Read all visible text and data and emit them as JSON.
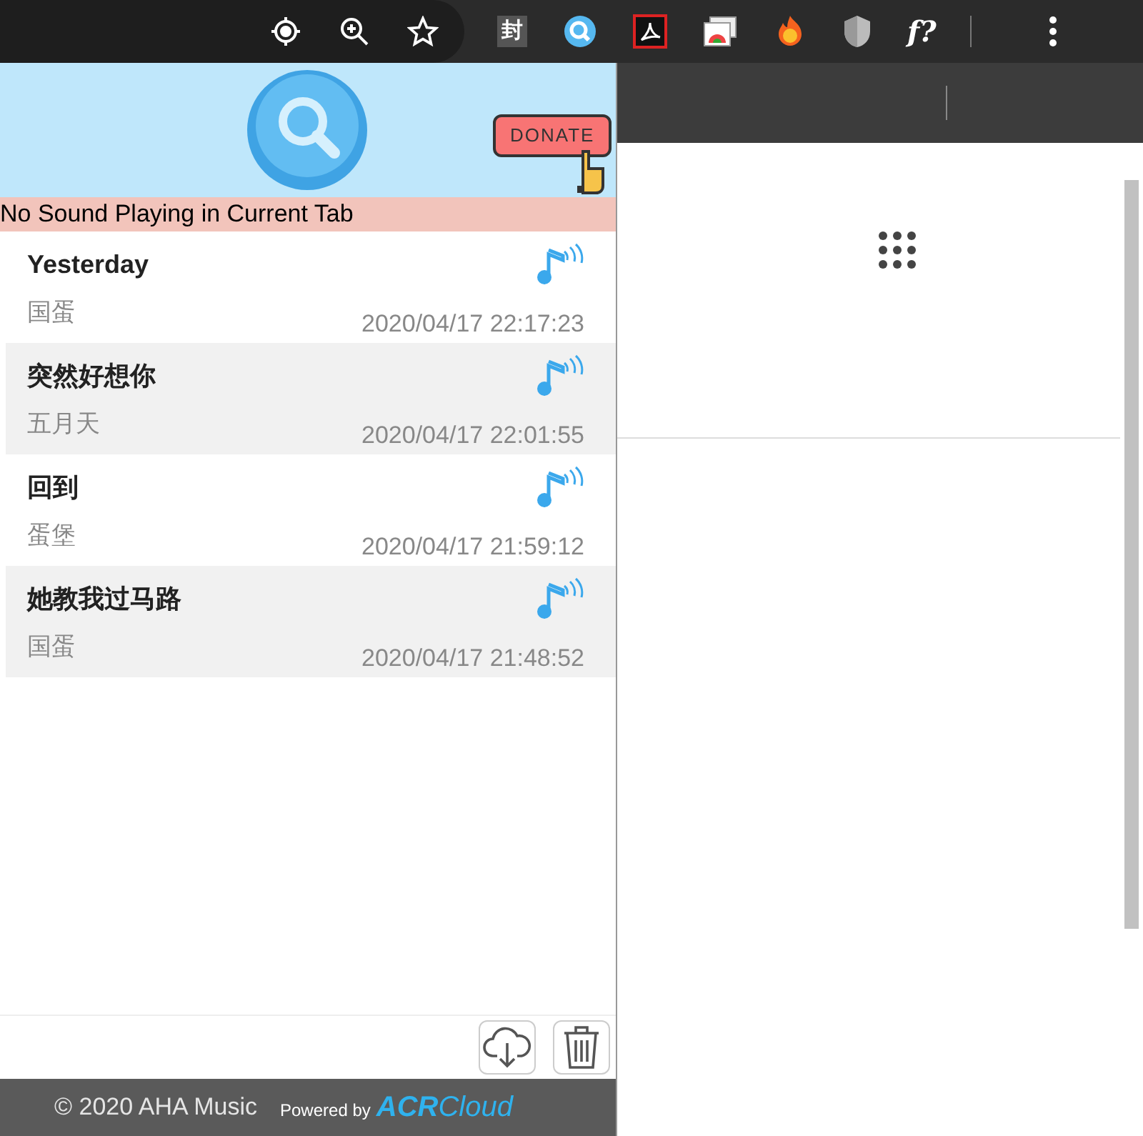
{
  "browser_toolbar": {
    "extension_labels": [
      "封",
      "f?"
    ]
  },
  "popup": {
    "donate_button": "DONATE",
    "status_banner": "No Sound Playing in Current Tab",
    "history": [
      {
        "title": "Yesterday",
        "artist": "国蛋",
        "time": "2020/04/17 22:17:23"
      },
      {
        "title": "突然好想你",
        "artist": "五月天",
        "time": "2020/04/17 22:01:55"
      },
      {
        "title": "回到",
        "artist": "蛋堡",
        "time": "2020/04/17 21:59:12"
      },
      {
        "title": "她教我过马路",
        "artist": "国蛋",
        "time": "2020/04/17 21:48:52"
      }
    ],
    "footer": {
      "copyright": "© 2020 AHA Music",
      "powered_by": "Powered by",
      "brand_bold": "ACR",
      "brand_light": "Cloud"
    }
  }
}
